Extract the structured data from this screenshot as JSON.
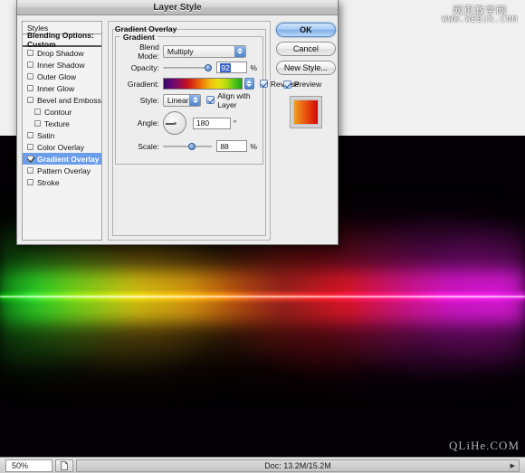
{
  "app": {
    "watermark_top_cn": "网页教学网",
    "watermark_top_url": "WWW.WEBJX.COM",
    "watermark_bottom": "QLiHe.COM"
  },
  "status_bar": {
    "zoom": "50%",
    "doc_info": "Doc: 13.2M/15.2M",
    "proxy_icon": "document-icon",
    "arrow_icon": "right-triangle-icon"
  },
  "dialog": {
    "title": "Layer Style",
    "styles_panel": {
      "header": "Styles",
      "blending_options": "Blending Options: Custom",
      "items": [
        {
          "label": "Drop Shadow",
          "checked": false,
          "sub": false,
          "selected": false
        },
        {
          "label": "Inner Shadow",
          "checked": false,
          "sub": false,
          "selected": false
        },
        {
          "label": "Outer Glow",
          "checked": false,
          "sub": false,
          "selected": false
        },
        {
          "label": "Inner Glow",
          "checked": false,
          "sub": false,
          "selected": false
        },
        {
          "label": "Bevel and Emboss",
          "checked": false,
          "sub": false,
          "selected": false
        },
        {
          "label": "Contour",
          "checked": false,
          "sub": true,
          "selected": false
        },
        {
          "label": "Texture",
          "checked": false,
          "sub": true,
          "selected": false
        },
        {
          "label": "Satin",
          "checked": false,
          "sub": false,
          "selected": false
        },
        {
          "label": "Color Overlay",
          "checked": false,
          "sub": false,
          "selected": false
        },
        {
          "label": "Gradient Overlay",
          "checked": true,
          "sub": false,
          "selected": true
        },
        {
          "label": "Pattern Overlay",
          "checked": false,
          "sub": false,
          "selected": false
        },
        {
          "label": "Stroke",
          "checked": false,
          "sub": false,
          "selected": false
        }
      ]
    },
    "settings": {
      "section_title": "Gradient Overlay",
      "group_title": "Gradient",
      "blend_mode": {
        "label": "Blend Mode:",
        "value": "Multiply"
      },
      "opacity": {
        "label": "Opacity:",
        "value": "92",
        "unit": "%"
      },
      "gradient": {
        "label": "Gradient:",
        "reverse_label": "Reverse",
        "reverse_checked": true
      },
      "style": {
        "label": "Style:",
        "value": "Linear",
        "align_label": "Align with Layer",
        "align_checked": true
      },
      "angle": {
        "label": "Angle:",
        "value": "180",
        "unit": "°"
      },
      "scale": {
        "label": "Scale:",
        "value": "88",
        "unit": "%"
      }
    },
    "buttons": {
      "ok": "OK",
      "cancel": "Cancel",
      "new_style": "New Style...",
      "preview_label": "Preview",
      "preview_checked": true
    }
  }
}
